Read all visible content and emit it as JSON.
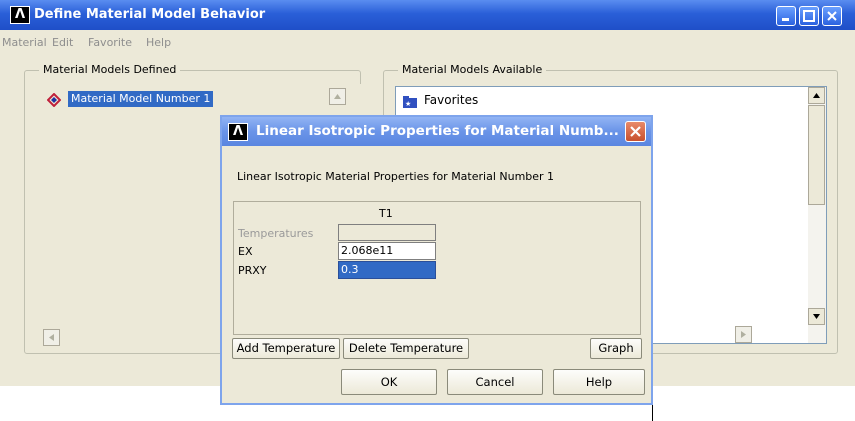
{
  "main_window": {
    "title": "Define Material Model Behavior",
    "menu": [
      "Material",
      "Edit",
      "Favorite",
      "Help"
    ],
    "defined_group": {
      "label": "Material Models Defined",
      "items": [
        "Material Model Number 1"
      ]
    },
    "available_group": {
      "label": "Material Models Available",
      "items": [
        "Favorites"
      ]
    }
  },
  "dialog": {
    "title": "Linear Isotropic Properties for Material Numb...",
    "heading": "Linear Isotropic Material Properties for Material Number 1",
    "column_header": "T1",
    "rows": [
      {
        "label": "Temperatures",
        "value": ""
      },
      {
        "label": "EX",
        "value": "2.068e11"
      },
      {
        "label": "PRXY",
        "value": "0.3"
      }
    ],
    "buttons": {
      "add_temperature": "Add Temperature",
      "delete_temperature": "Delete Temperature",
      "graph": "Graph",
      "ok": "OK",
      "cancel": "Cancel",
      "help": "Help"
    }
  },
  "colors": {
    "title_bar": "#2a5fd8",
    "selection": "#316ac5",
    "window_bg": "#ece9d8"
  }
}
